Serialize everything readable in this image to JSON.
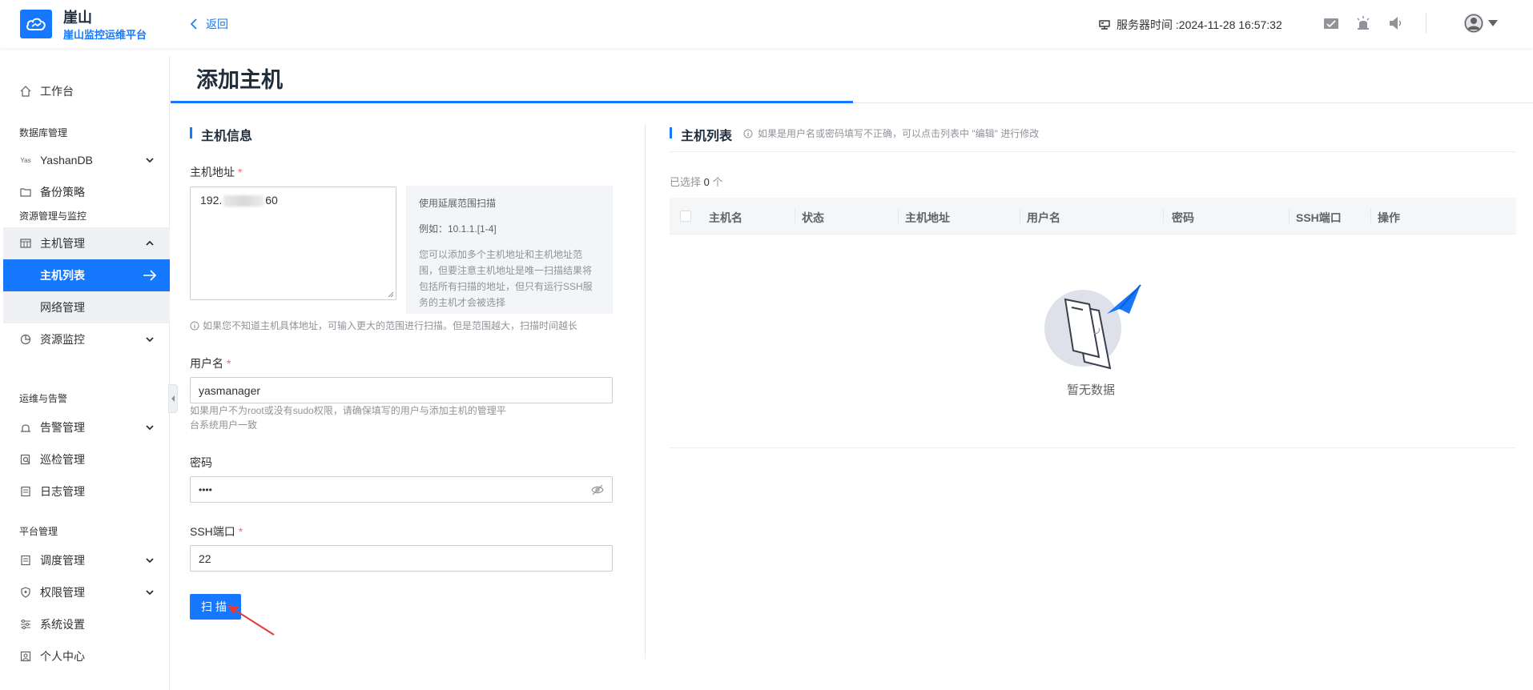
{
  "header": {
    "brand_name": "崖山",
    "brand_sub": "崖山监控运维平台",
    "back_label": "返回",
    "server_time": "服务器时间 :2024-11-28 16:57:32"
  },
  "sidebar": {
    "workbench": "工作台",
    "group_db": "数据库管理",
    "yashandb": "YashanDB",
    "backup": "备份策略",
    "group_res": "资源管理与监控",
    "host_mgmt": "主机管理",
    "host_list": "主机列表",
    "network": "网络管理",
    "res_monitor": "资源监控",
    "group_ops": "运维与告警",
    "alert": "告警管理",
    "inspect": "巡检管理",
    "log": "日志管理",
    "group_platform": "平台管理",
    "schedule": "调度管理",
    "perm": "权限管理",
    "settings": "系统设置",
    "personal": "个人中心"
  },
  "page": {
    "title": "添加主机"
  },
  "form": {
    "section_title": "主机信息",
    "host_label": "主机地址",
    "host_value_prefix": "192.",
    "host_value_suffix": "60",
    "hint_title": "使用延展范围扫描",
    "hint_example": "例如：10.1.1.[1-4]",
    "hint_body": "您可以添加多个主机地址和主机地址范围，但要注意主机地址是唯一扫描结果将包括所有扫描的地址，但只有运行SSH服务的主机才会被选择",
    "host_note": "如果您不知道主机具体地址，可输入更大的范围进行扫描。但是范围越大，扫描时间越长",
    "user_label": "用户名",
    "user_value": "yasmanager",
    "user_note": "如果用户不为root或没有sudo权限，请确保填写的用户与添加主机的管理平台系统用户一致",
    "pwd_label": "密码",
    "pwd_value": "••••",
    "ssh_label": "SSH端口",
    "ssh_value": "22",
    "scan_label": "扫描"
  },
  "hostlist": {
    "section_title": "主机列表",
    "hint": "如果是用户名或密码填写不正确，可以点击列表中 \"编辑\" 进行修改",
    "selected_prefix": "已选择",
    "selected_count": "0",
    "selected_suffix": "个",
    "columns": [
      "主机名",
      "状态",
      "主机地址",
      "用户名",
      "密码",
      "SSH端口",
      "操作"
    ],
    "empty_text": "暂无数据"
  },
  "colors": {
    "primary": "#1677ff",
    "required": "#f56c6c"
  }
}
